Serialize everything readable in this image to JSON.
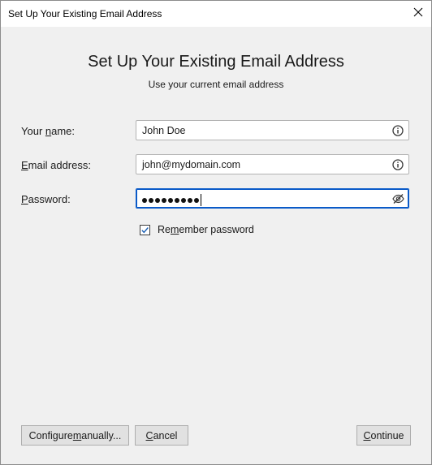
{
  "window": {
    "title": "Set Up Your Existing Email Address",
    "close_icon": "close-icon"
  },
  "header": {
    "title": "Set Up Your Existing Email Address",
    "subtitle": "Use your current email address"
  },
  "form": {
    "name": {
      "label_pre": "Your ",
      "label_accel": "n",
      "label_post": "ame:",
      "value": "John Doe",
      "icon": "info-icon"
    },
    "email": {
      "label_pre": "",
      "label_accel": "E",
      "label_post": "mail address:",
      "value": "john@mydomain.com",
      "icon": "info-icon"
    },
    "password": {
      "label_pre": "",
      "label_accel": "P",
      "label_post": "assword:",
      "masked_length": 9,
      "icon": "eye-slash-icon"
    },
    "remember": {
      "label_pre": "Re",
      "label_accel": "m",
      "label_post": "ember password",
      "checked": true
    }
  },
  "buttons": {
    "configure": {
      "pre": "Configure ",
      "accel": "m",
      "post": "anually..."
    },
    "cancel": {
      "pre": "",
      "accel": "C",
      "post": "ancel"
    },
    "continue": {
      "pre": "",
      "accel": "C",
      "post": "ontinue"
    }
  },
  "colors": {
    "background": "#f0f0f0",
    "focus_border": "#0a5ac8",
    "button_bg": "#e1e1e1"
  }
}
